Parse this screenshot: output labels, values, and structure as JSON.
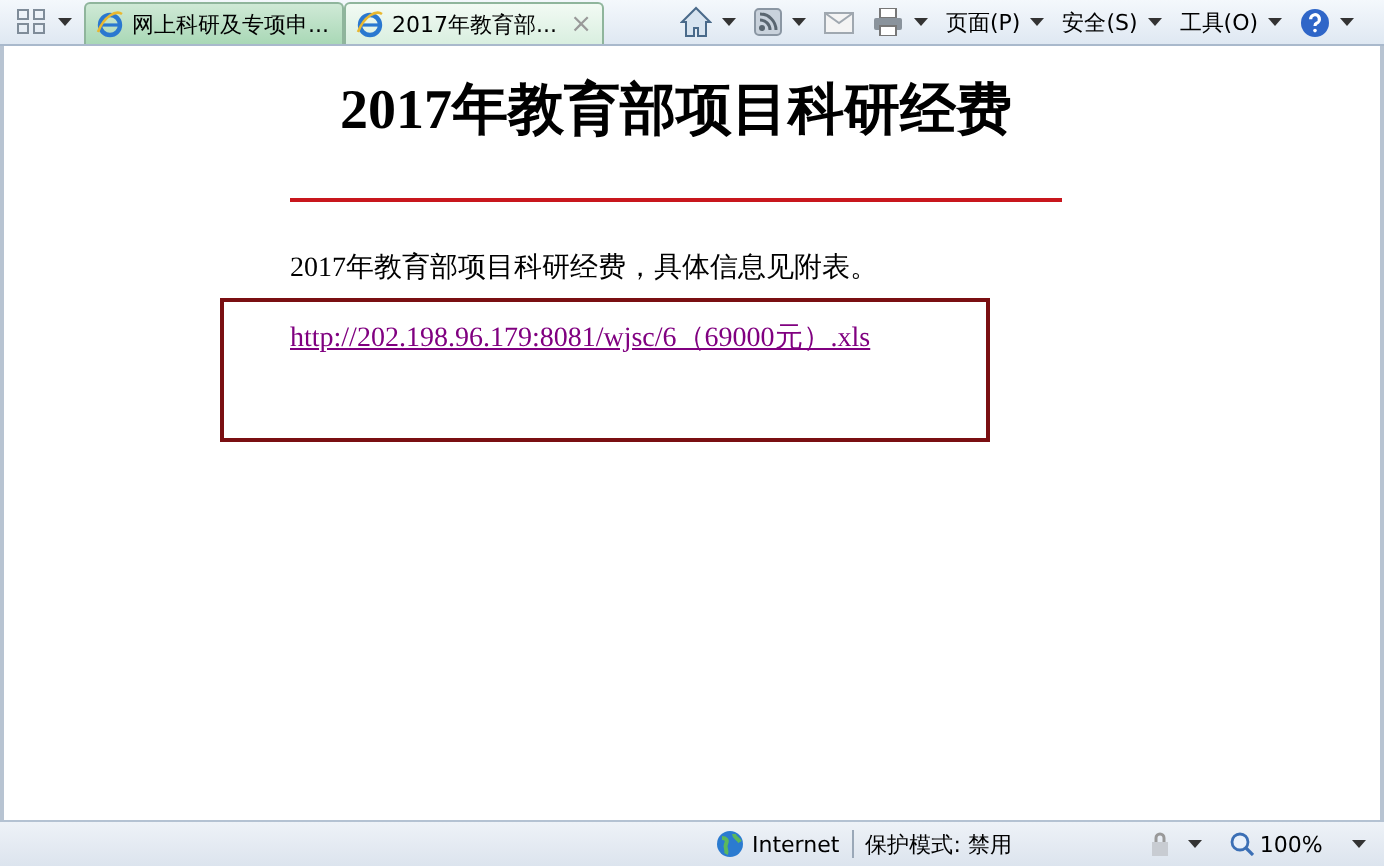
{
  "browser": {
    "tabs": [
      {
        "title": "网上科研及专项申...",
        "selected": false
      },
      {
        "title": "2017年教育部...",
        "selected": true
      }
    ],
    "close_tab": "×",
    "commands": [
      {
        "kind": "home"
      },
      {
        "kind": "feeds"
      },
      {
        "kind": "mail"
      },
      {
        "kind": "print"
      },
      {
        "kind": "menu",
        "label": "页面(P)"
      },
      {
        "kind": "menu",
        "label": "安全(S)"
      },
      {
        "kind": "menu",
        "label": "工具(O)"
      },
      {
        "kind": "help"
      }
    ]
  },
  "page": {
    "heading": "2017年教育部项目科研经费",
    "intro": "2017年教育部项目科研经费，具体信息见附表。",
    "attachment_link": "http://202.198.96.179:8081/wjsc/6（69000元）.xls"
  },
  "status_bar": {
    "zone": "Internet",
    "protected_mode": "保护模式: 禁用",
    "zoom": "100%"
  }
}
